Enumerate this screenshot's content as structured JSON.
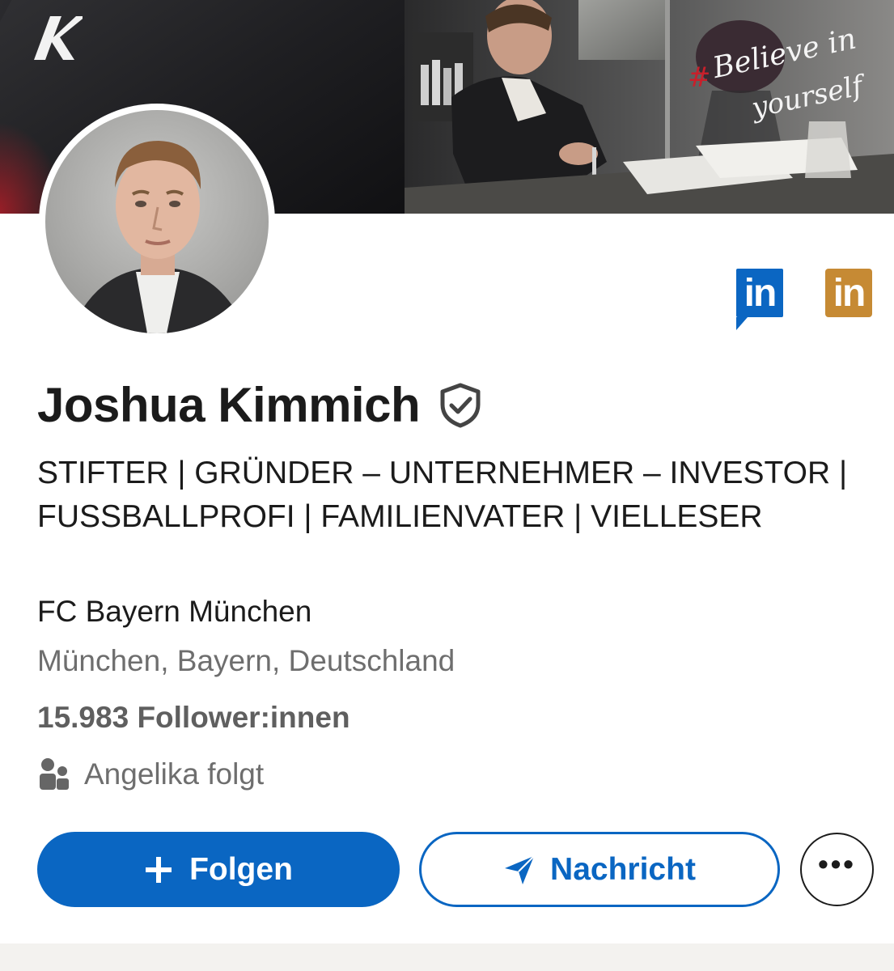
{
  "banner": {
    "brand_icon": "k-logo-icon",
    "slogan_hash": "#",
    "slogan_line1": "Believe in",
    "slogan_line2": "yourself"
  },
  "profile": {
    "name": "Joshua Kimmich",
    "verified_icon": "verified-shield-icon",
    "headline": "STIFTER | GRÜNDER – UNTERNEHMER – INVESTOR | FUSSBALLPROFI | FAMILIENVATER | VIELLESER",
    "company": "FC Bayern München",
    "location": "München, Bayern, Deutschland",
    "followers": "15.983 Follower:innen",
    "mutual_icon": "people-icon",
    "mutual_text": "Angelika folgt"
  },
  "badges": {
    "linkedin_blue_label": "in",
    "linkedin_gold_label": "in"
  },
  "actions": {
    "follow_label": "Folgen",
    "follow_icon": "plus-icon",
    "message_label": "Nachricht",
    "message_icon": "send-icon",
    "more_label": "•••"
  },
  "colors": {
    "accent": "#0a66c2",
    "gold": "#c68a34",
    "slogan_red": "#c8202b"
  }
}
